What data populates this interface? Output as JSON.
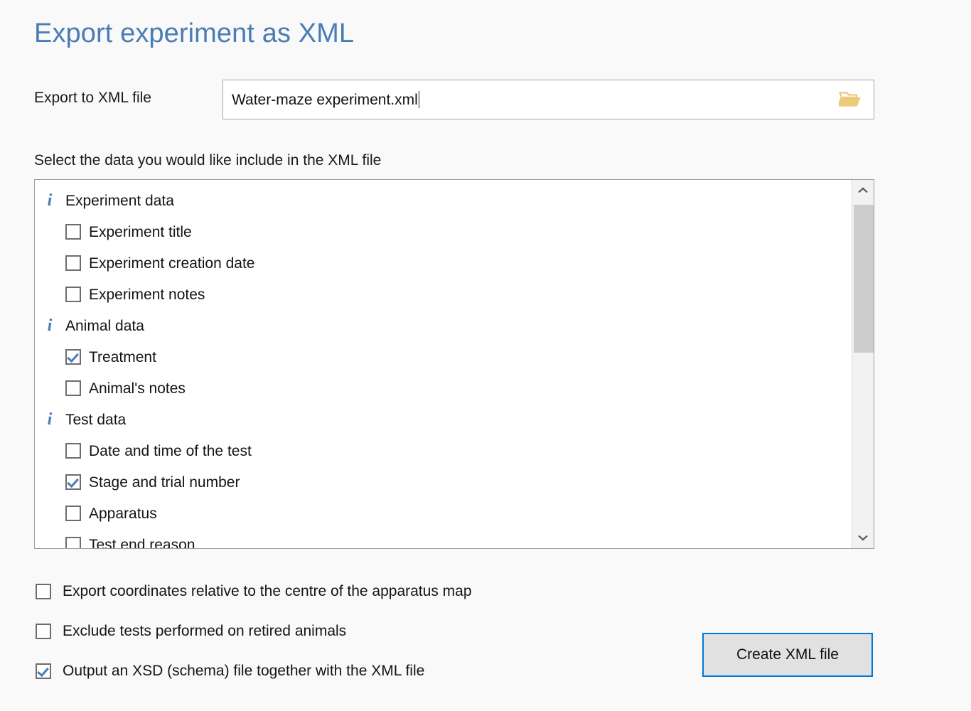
{
  "window": {
    "title": "Export experiment as XML",
    "background_color": "#f9f9f9",
    "accent_color": "#4a7cb5",
    "focus_color": "#0078d7"
  },
  "export_file": {
    "label": "Export to XML file",
    "value": "Water-maze experiment.xml",
    "placeholder": "Water-maze experiment.xml",
    "browse_icon": "folder-open-icon",
    "browse_icon_color": "#edc97a"
  },
  "select_section": {
    "label": "Select the data you would like include in the XML file",
    "items": [
      {
        "type": "group",
        "icon": "info-icon",
        "label": "Experiment data"
      },
      {
        "type": "option",
        "label": "Experiment title",
        "checked": false
      },
      {
        "type": "option",
        "label": "Experiment creation date",
        "checked": false
      },
      {
        "type": "option",
        "label": "Experiment notes",
        "checked": false
      },
      {
        "type": "group",
        "icon": "info-icon",
        "label": "Animal data"
      },
      {
        "type": "option",
        "label": "Treatment",
        "checked": true
      },
      {
        "type": "option",
        "label": "Animal's notes",
        "checked": false
      },
      {
        "type": "group",
        "icon": "info-icon",
        "label": "Test data"
      },
      {
        "type": "option",
        "label": "Date and time of the test",
        "checked": false
      },
      {
        "type": "option",
        "label": "Stage and trial number",
        "checked": true
      },
      {
        "type": "option",
        "label": "Apparatus",
        "checked": false
      },
      {
        "type": "option",
        "label": "Test end reason",
        "checked": false
      }
    ],
    "scrollbar": {
      "up_arrow_icon": "chevron-up-icon",
      "down_arrow_icon": "chevron-down-icon"
    }
  },
  "options": [
    {
      "label": "Export coordinates relative to the centre of the apparatus map",
      "checked": false
    },
    {
      "label": "Exclude tests performed on retired animals",
      "checked": false
    },
    {
      "label": "Output an XSD (schema) file together with the XML file",
      "checked": true
    }
  ],
  "actions": {
    "create_label": "Create XML file"
  }
}
